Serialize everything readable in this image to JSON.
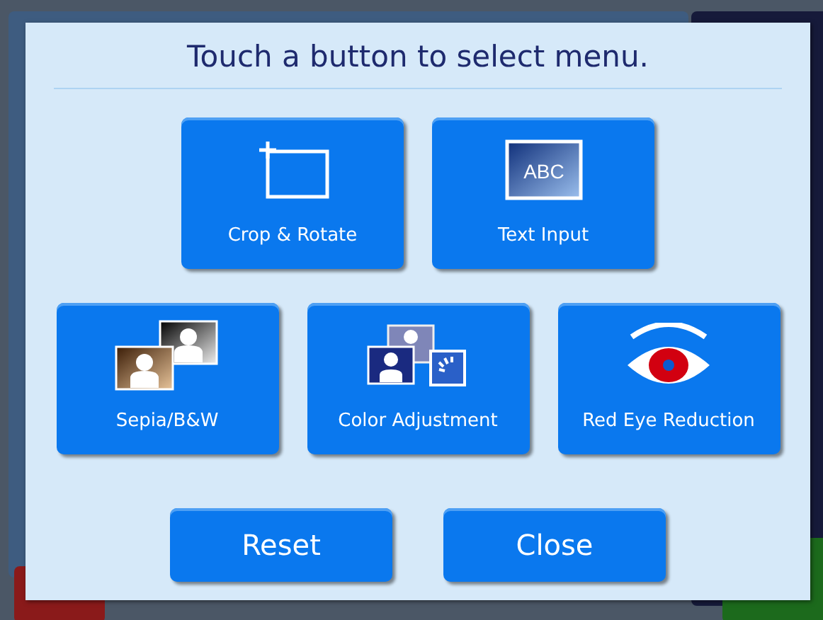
{
  "dialog": {
    "title": "Touch a button to select menu.",
    "menu_rows": [
      [
        {
          "label": "Crop & Rotate",
          "kind": "crop"
        },
        {
          "label": "Text Input",
          "kind": "text",
          "icon_text": "ABC"
        }
      ],
      [
        {
          "label": "Sepia/B&W",
          "kind": "sepia"
        },
        {
          "label": "Color Adjustment",
          "kind": "color"
        },
        {
          "label": "Red Eye Reduction",
          "kind": "redeye"
        }
      ]
    ],
    "buttons": [
      "Reset",
      "Close"
    ]
  }
}
